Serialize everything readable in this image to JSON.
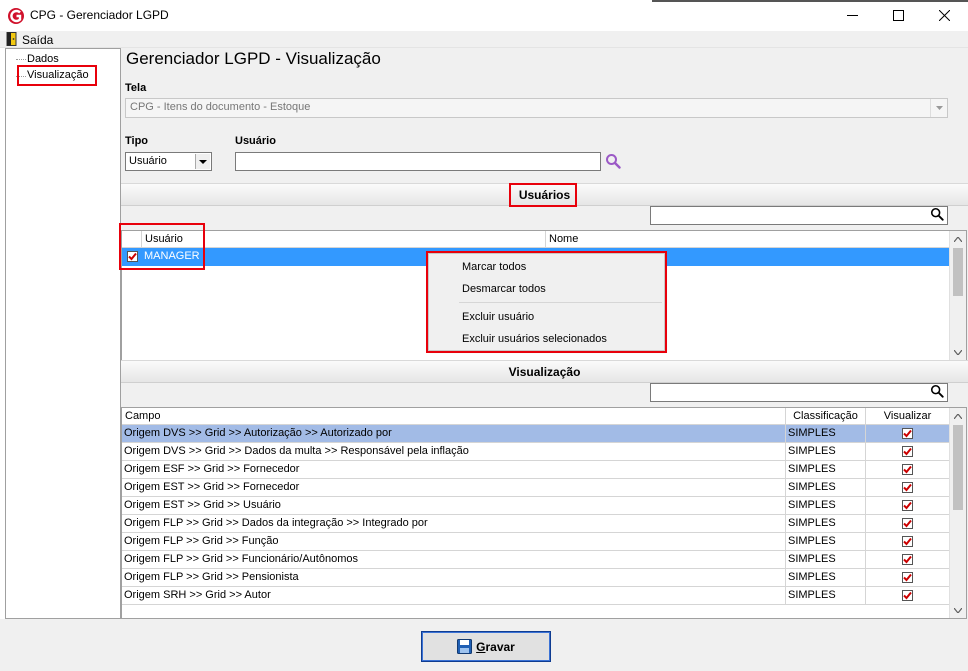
{
  "window": {
    "title": "CPG - Gerenciador LGPD",
    "minimize_icon": "minimize-icon",
    "maximize_icon": "maximize-icon",
    "close_icon": "close-icon"
  },
  "menubar": {
    "exit_label": "Saída"
  },
  "tree": {
    "items": [
      "Dados",
      "Visualização"
    ]
  },
  "page": {
    "title": "Gerenciador LGPD - Visualização"
  },
  "tela": {
    "label": "Tela",
    "value": "CPG - Itens do documento - Estoque"
  },
  "tipo": {
    "label": "Tipo",
    "value": "Usuário"
  },
  "usuario": {
    "label": "Usuário",
    "value": ""
  },
  "usuarios_section": {
    "title": "Usuários",
    "columns": [
      "Usuário",
      "Nome"
    ],
    "rows": [
      {
        "checked": true,
        "usuario": "MANAGER",
        "nome": ""
      }
    ]
  },
  "context_menu": {
    "items": [
      "Marcar todos",
      "Desmarcar todos",
      "Excluir usuário",
      "Excluir usuários selecionados"
    ]
  },
  "visualizacao_section": {
    "title": "Visualização",
    "columns": [
      "Campo",
      "Classificação",
      "Visualizar"
    ],
    "rows": [
      {
        "campo": "Origem DVS >> Grid >> Autorização >> Autorizado por",
        "classificacao": "SIMPLES",
        "visualizar": true
      },
      {
        "campo": "Origem DVS >> Grid >> Dados da multa >> Responsável pela inflação",
        "classificacao": "SIMPLES",
        "visualizar": true
      },
      {
        "campo": "Origem ESF >> Grid >> Fornecedor",
        "classificacao": "SIMPLES",
        "visualizar": true
      },
      {
        "campo": "Origem EST >> Grid >> Fornecedor",
        "classificacao": "SIMPLES",
        "visualizar": true
      },
      {
        "campo": "Origem EST >> Grid >> Usuário",
        "classificacao": "SIMPLES",
        "visualizar": true
      },
      {
        "campo": "Origem FLP >> Grid >> Dados da integração >> Integrado por",
        "classificacao": "SIMPLES",
        "visualizar": true
      },
      {
        "campo": "Origem FLP >> Grid >> Função",
        "classificacao": "SIMPLES",
        "visualizar": true
      },
      {
        "campo": "Origem FLP >> Grid >> Funcionário/Autônomos",
        "classificacao": "SIMPLES",
        "visualizar": true
      },
      {
        "campo": "Origem FLP >> Grid >> Pensionista",
        "classificacao": "SIMPLES",
        "visualizar": true
      },
      {
        "campo": "Origem SRH >> Grid >> Autor",
        "classificacao": "SIMPLES",
        "visualizar": true
      }
    ]
  },
  "footer": {
    "save_label_first": "G",
    "save_label_rest": "ravar"
  },
  "colors": {
    "highlight_box": "#e8000b",
    "selected_row": "#a2bbe6",
    "selected_row_bright": "#3399ff",
    "check_mark": "#cc0000",
    "search_icon": "#9b59c6"
  }
}
